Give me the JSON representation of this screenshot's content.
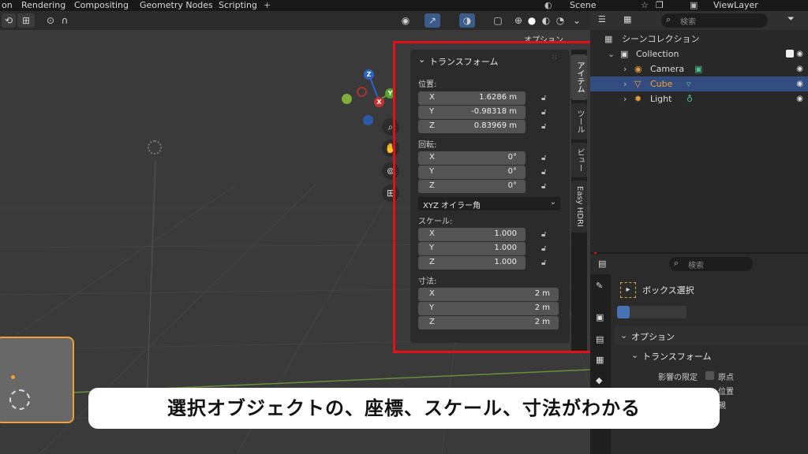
{
  "topbar": {
    "tabs": [
      "on",
      "Rendering",
      "Compositing",
      "Geometry Nodes",
      "Scripting"
    ],
    "add": "+",
    "scene": "Scene",
    "view_layer": "ViewLayer"
  },
  "viewport": {
    "options_label": "オプション"
  },
  "gizmo": {
    "x": "X",
    "y": "Y",
    "z": "Z"
  },
  "npanel": {
    "title": "トランスフォーム",
    "location_label": "位置:",
    "location": [
      {
        "axis": "X",
        "value": "1.6286 m"
      },
      {
        "axis": "Y",
        "value": "-0.98318 m"
      },
      {
        "axis": "Z",
        "value": "0.83969 m"
      }
    ],
    "rotation_label": "回転:",
    "rotation": [
      {
        "axis": "X",
        "value": "0°"
      },
      {
        "axis": "Y",
        "value": "0°"
      },
      {
        "axis": "Z",
        "value": "0°"
      }
    ],
    "rotation_mode": "XYZ オイラー角",
    "scale_label": "スケール:",
    "scale": [
      {
        "axis": "X",
        "value": "1.000"
      },
      {
        "axis": "Y",
        "value": "1.000"
      },
      {
        "axis": "Z",
        "value": "1.000"
      }
    ],
    "dimensions_label": "寸法:",
    "dimensions": [
      {
        "axis": "X",
        "value": "2 m"
      },
      {
        "axis": "Y",
        "value": "2 m"
      },
      {
        "axis": "Z",
        "value": "2 m"
      }
    ]
  },
  "vtabs": [
    "アイテム",
    "ツール",
    "ビュー",
    "Easy HDRI"
  ],
  "outliner": {
    "search_placeholder": "検索",
    "scene_collection": "シーンコレクション",
    "items": [
      {
        "label": "Collection"
      },
      {
        "label": "Camera"
      },
      {
        "label": "Cube"
      },
      {
        "label": "Light"
      }
    ]
  },
  "properties": {
    "search_placeholder": "検索",
    "tool_name": "ボックス選択",
    "options": "オプション",
    "transform": "トランスフォーム",
    "affect_only": "影響の限定",
    "origin": "原点",
    "location": "位置",
    "parents": "親"
  },
  "caption": "選択オブジェクトの、座標、スケール、寸法がわかる",
  "colors": {
    "highlight": "#e3101a",
    "selected_row": "#334d80",
    "object_orange": "#f0a038"
  }
}
